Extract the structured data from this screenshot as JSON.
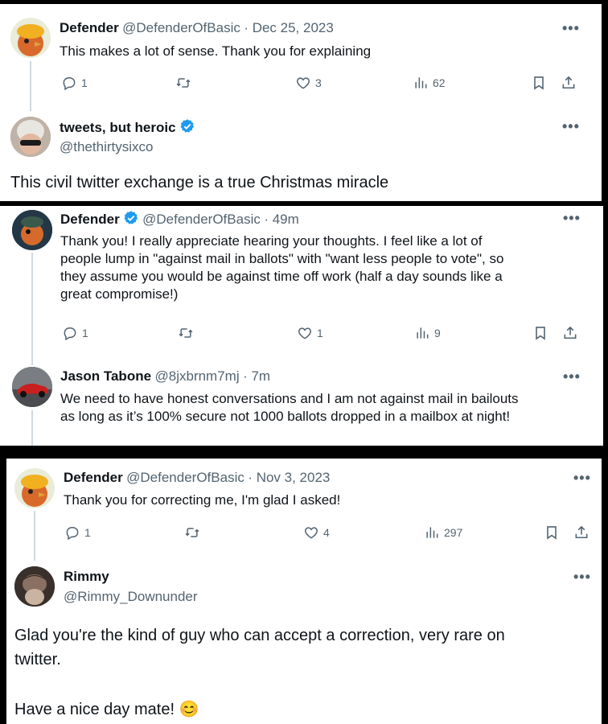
{
  "panel1": {
    "reply": {
      "name": "Defender",
      "handle": "@DefenderOfBasic",
      "date": "· Dec 25, 2023",
      "text": "This makes a lot of sense. Thank you for explaining",
      "stats": {
        "replies": "1",
        "likes": "3",
        "views": "62"
      }
    },
    "response": {
      "name": "tweets, but heroic",
      "handle": "@thethirtysixco",
      "text": "This civil twitter exchange is a true Christmas miracle"
    }
  },
  "panel2": {
    "reply": {
      "name": "Defender",
      "handle": "@DefenderOfBasic",
      "date": "· 49m",
      "lines": [
        "Thank you! I really appreciate hearing your thoughts. I feel like a lot of",
        "people lump in \"against mail in ballots\" with \"want less people to vote\", so",
        "they assume you would be against time off work (half a day sounds like a",
        "great compromise!)"
      ],
      "stats": {
        "replies": "1",
        "likes": "1",
        "views": "9"
      }
    },
    "response": {
      "name": "Jason Tabone",
      "handle": "@8jxbrnm7mj",
      "date": "· 7m",
      "lines": [
        "We need to have honest conversations and I am not against mail in bailouts",
        "as long as it’s 100% secure not 1000 ballots dropped in a mailbox at night!"
      ]
    }
  },
  "panel3": {
    "reply": {
      "name": "Defender",
      "handle": "@DefenderOfBasic",
      "date": "· Nov 3, 2023",
      "text": "Thank you for correcting me, I'm glad I asked!",
      "stats": {
        "replies": "1",
        "likes": "4",
        "views": "297"
      }
    },
    "response": {
      "name": "Rimmy",
      "handle": "@Rimmy_Downunder",
      "line1": "Glad you're the kind of guy who can accept a correction, very rare on",
      "line2": "twitter.",
      "line3": "Have a nice day mate!",
      "emoji": "😊"
    }
  },
  "icons": [
    "reply-icon",
    "retweet-icon",
    "like-icon",
    "views-icon",
    "bookmark-icon",
    "share-icon",
    "more-icon",
    "verified-badge-icon"
  ],
  "colors": {
    "text": "#0f1419",
    "muted": "#536471",
    "verified": "#1d9bf0",
    "line": "#cfd9de"
  }
}
